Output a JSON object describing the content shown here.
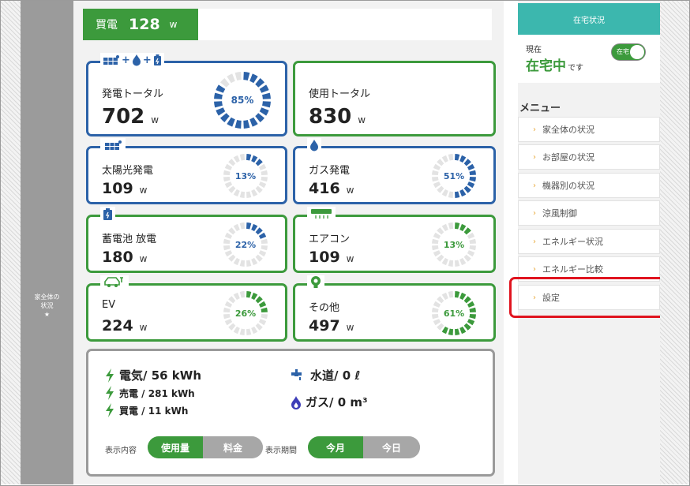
{
  "header": {
    "buy_label": "買電",
    "buy_value": "128",
    "buy_unit": "w"
  },
  "left_tab": {
    "label_line1": "家全体の",
    "label_line2": "状況",
    "star": "★"
  },
  "cards": {
    "generation_total": {
      "title": "発電トータル",
      "value": "702",
      "unit": "w",
      "percent": "85%",
      "fill": 0.85,
      "icon_plus": "+"
    },
    "usage_total": {
      "title": "使用トータル",
      "value": "830",
      "unit": "w"
    },
    "solar": {
      "title": "太陽光発電",
      "value": "109",
      "unit": "w",
      "percent": "13%",
      "fill": 0.13
    },
    "gas": {
      "title": "ガス発電",
      "value": "416",
      "unit": "w",
      "percent": "51%",
      "fill": 0.51
    },
    "battery": {
      "title": "蓄電池 放電",
      "value": "180",
      "unit": "w",
      "percent": "22%",
      "fill": 0.22
    },
    "aircon": {
      "title": "エアコン",
      "value": "109",
      "unit": "w",
      "percent": "13%",
      "fill": 0.13
    },
    "ev": {
      "title": "EV",
      "value": "224",
      "unit": "w",
      "percent": "26%",
      "fill": 0.26
    },
    "other": {
      "title": "その他",
      "value": "497",
      "unit": "w",
      "percent": "61%",
      "fill": 0.61
    }
  },
  "summary": {
    "electricity": "電気/ 56 kWh",
    "sold": "売電 / 281 kWh",
    "bought": "買電 / 11 kWh",
    "water": "水道/ 0 ℓ",
    "gas": "ガス/ 0 m³",
    "display_content_label": "表示内容",
    "content_options": [
      "使用量",
      "料金"
    ],
    "display_period_label": "表示期間",
    "period_options": [
      "今月",
      "今日"
    ]
  },
  "status": {
    "header": "在宅状況",
    "now": "現在",
    "home": "在宅中",
    "desu": "です",
    "toggle_label": "在宅"
  },
  "menu": {
    "heading": "メニュー",
    "items": [
      "家全体の状況",
      "お部屋の状況",
      "機器別の状況",
      "涼風制御",
      "エネルギー状況",
      "エネルギー比較",
      "設定"
    ],
    "arrow": "›"
  },
  "colors": {
    "green": "#3c9a3c",
    "blue": "#2c62a8",
    "teal": "#3cb7ae",
    "highlight": "#e0141f"
  }
}
